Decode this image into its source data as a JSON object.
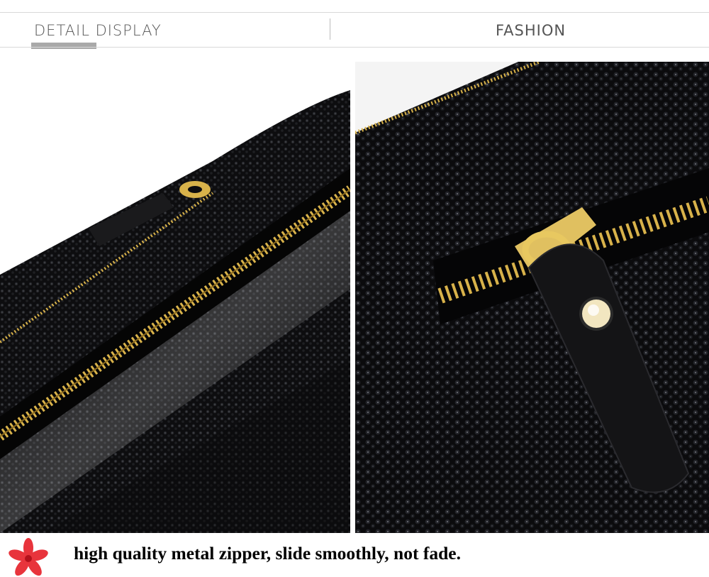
{
  "header": {
    "left_title": "DETAIL DISPLAY",
    "right_title": "FASHION"
  },
  "photos": [
    {
      "subject": "wallet-zipper-closeup",
      "icon": "wallet-zipper-image"
    },
    {
      "subject": "wallet-zipper-pull-tab",
      "icon": "zipper-pull-image"
    }
  ],
  "footer": {
    "icon": "flower-icon",
    "caption": "high quality metal zipper, slide smoothly, not fade."
  },
  "colors": {
    "leather": "#0b0b0b",
    "zipper_gold": "#d8b24a",
    "rule_gray": "#d9d9d9",
    "underline_gray": "#a9a9a9",
    "flower_red": "#e8343c"
  }
}
